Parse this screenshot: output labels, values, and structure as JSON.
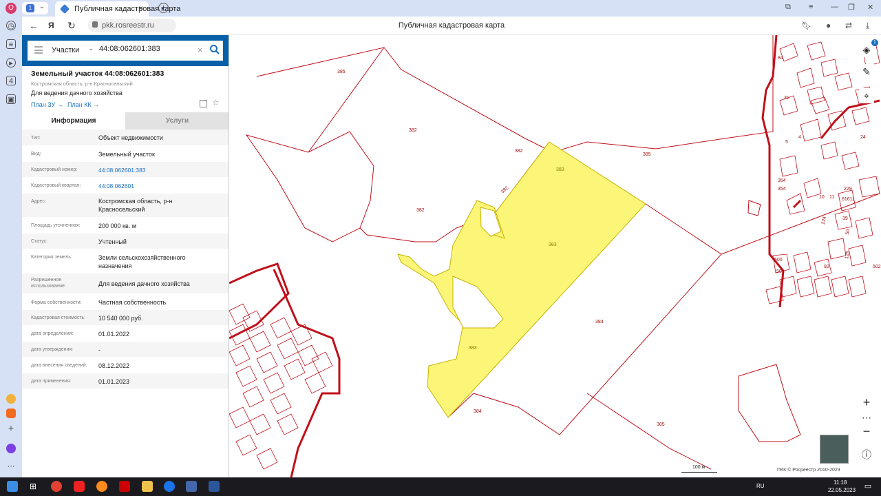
{
  "browser": {
    "profile_letter": "O",
    "tab_group_count": "1",
    "tab_title": "Публичная кадастровая карта",
    "url": "pkk.rosreestr.ru",
    "page_title": "Публичная кадастровая карта",
    "sidebar_badge": "4"
  },
  "search": {
    "type": "Участки",
    "value": "44:08:062601:383"
  },
  "parcel": {
    "title": "Земельный участок 44:08:062601:383",
    "address_short": "Костромская область, р-н Красносельский",
    "use": "Для ведения дачного хозяйства",
    "plan_zu": "План ЗУ →",
    "plan_kk": "План КК →"
  },
  "tabs": {
    "info": "Информация",
    "services": "Услуги"
  },
  "info_rows": [
    {
      "label": "Тип:",
      "value": "Объект недвижимости"
    },
    {
      "label": "Вид:",
      "value": "Земельный участок"
    },
    {
      "label": "Кадастровый номер:",
      "value": "44:08:062601:383"
    },
    {
      "label": "Кадастровый квартал:",
      "value": "44:08:062601"
    },
    {
      "label": "Адрес:",
      "value": "Костромская область, р-н Красносельский"
    },
    {
      "label": "Площадь уточненная:",
      "value": "200 000 кв. м"
    },
    {
      "label": "Статус:",
      "value": "Учтенный"
    },
    {
      "label": "Категория земель:",
      "value": "Земли сельскохозяйственного назначения"
    },
    {
      "label": "Разрешенное использование:",
      "value": "Для ведения дачного хозяйства"
    },
    {
      "label": "Форма собственности:",
      "value": "Частная собственность"
    },
    {
      "label": "Кадастровая стоимость:",
      "value": "10 540 000 руб."
    },
    {
      "label": "дата определения:",
      "value": "01.01.2022"
    },
    {
      "label": "дата утверждения:",
      "value": "-"
    },
    {
      "label": "дата внесения сведений:",
      "value": "08.12.2022"
    },
    {
      "label": "дата применения:",
      "value": "01.01.2023"
    }
  ],
  "map": {
    "labels": {
      "l385a": "385",
      "l382a": "382",
      "l382b": "382",
      "l382c": "382",
      "l382d": "382",
      "l383a": "383",
      "l383b": "383",
      "l383c": "383",
      "l385b": "385",
      "l384a": "384",
      "l384b": "384",
      "l385c": "385",
      "l61611": "61611",
      "l616": "616",
      "l500": "500",
      "l501": "501",
      "l502": "502",
      "l229": "229",
      "l354a": "354",
      "l354b": "354",
      "l92": "92",
      "l39": "39",
      "l125": "125",
      "l50": "50",
      "l24": "24",
      "l31": "31",
      "l5": "5",
      "l4": "4",
      "l84": "84",
      "l11": "11",
      "l10": "10",
      "l224": "224"
    },
    "scale": "100 м",
    "copyright": "ПКК © Росреестр 2010-2023",
    "layers_badge": "1"
  },
  "taskbar": {
    "lang": "RU",
    "time": "11:18",
    "date": "22.05.2023"
  },
  "colors": {
    "selected_fill": "#fbf677",
    "parcel_border": "#c0101a",
    "panel_blue": "#0960a8"
  }
}
